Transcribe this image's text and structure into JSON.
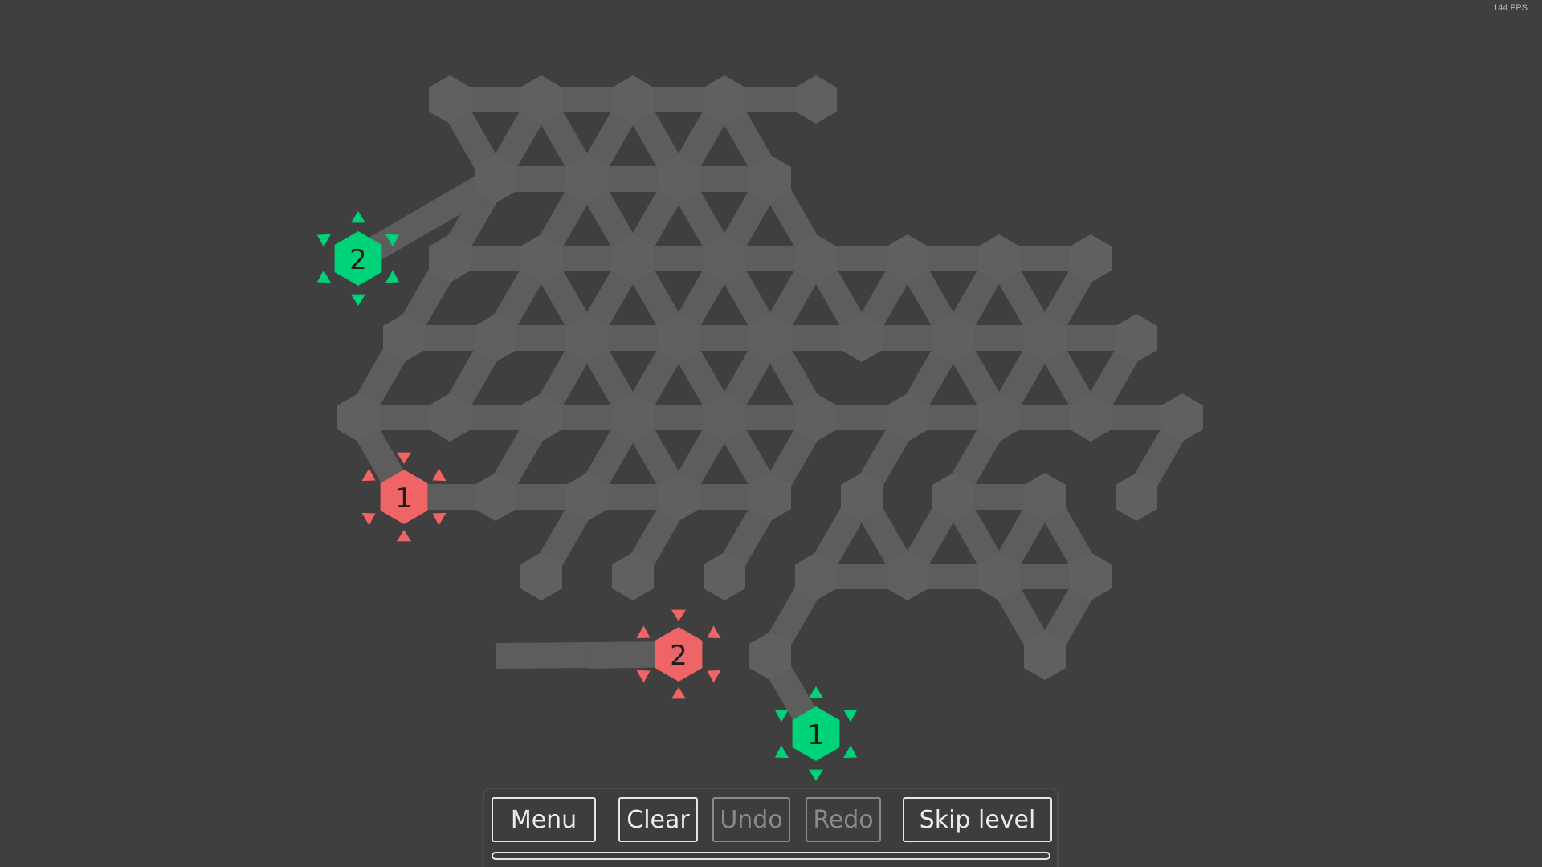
{
  "fps_label": "144 FPS",
  "colors": {
    "background": "#3f3f3f",
    "track": "#5d5d5d",
    "track_dark": "#4c4c4c",
    "joint": "#606060",
    "source_green": "#00d27a",
    "target_red": "#ef6464"
  },
  "nodes": [
    {
      "id": "green-2",
      "number": "2",
      "color": "green"
    },
    {
      "id": "red-1",
      "number": "1",
      "color": "red"
    },
    {
      "id": "red-2",
      "number": "2",
      "color": "red"
    },
    {
      "id": "green-1",
      "number": "1",
      "color": "green"
    }
  ],
  "toolbar": {
    "menu_label": "Menu",
    "clear_label": "Clear",
    "undo_label": "Undo",
    "redo_label": "Redo",
    "skip_label": "Skip level",
    "undo_enabled": false,
    "redo_enabled": false,
    "progress": 0
  }
}
